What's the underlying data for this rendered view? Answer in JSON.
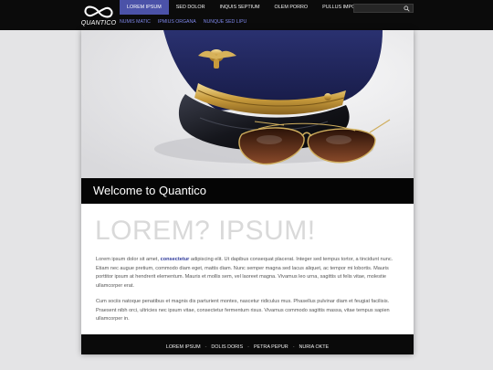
{
  "brand": {
    "name": "QUANTICO"
  },
  "nav": {
    "items": [
      {
        "label": "LOREM IPSUM",
        "active": true
      },
      {
        "label": "SED DOLOR"
      },
      {
        "label": "INQUIS SEPTIUM"
      },
      {
        "label": "OLEM PORRO"
      },
      {
        "label": "PULLUS IMPOUS"
      }
    ],
    "subitems": [
      {
        "label": "NUMIS MATIC"
      },
      {
        "label": "IPMIUS ORGANA"
      },
      {
        "label": "NUNQUE SED LIPU"
      }
    ]
  },
  "search": {
    "placeholder": ""
  },
  "hero": {
    "welcome": "Welcome to Quantico"
  },
  "content": {
    "headline": "LOREM? IPSUM!",
    "p1_before": "Lorem ipsum dolor sit amet, ",
    "p1_link": "consectetur",
    "p1_after": " adipiscing elit. Ut dapibus consequat placerat. Integer sed tempus tortor, a tincidunt nunc. Etiam nec augue pretium, commodo diam eget, mattis diam. Nunc semper magna sed lacus aliquet, ac tempor mi lobortis. Mauris porttitor ipsum at hendrerit elementum. Mauris et mollis sem, vel laoreet magna. Vivamus leo urna, sagittis ut felis vitae, molestie ullamcorper erat.",
    "p2": "Cum sociis natoque penatibus et magnis dis parturient montes, nascetur ridiculus mus. Phasellus pulvinar diam et feugiat facilisis. Praesent nibh orci, ultricies nec ipsum vitae, consectetur fermentum risus. Vivamus commodo sagittis massa, vitae tempus sapien ullamcorper in."
  },
  "footer": {
    "links": [
      "LOREM IPSUM",
      "DOLIS DORIS",
      "PETRA PEPUR",
      "NURIA OKTE"
    ],
    "separator": "-"
  },
  "colors": {
    "accent": "#4b52a8",
    "subnav": "#7d86e8",
    "link": "#2f3a9a"
  }
}
